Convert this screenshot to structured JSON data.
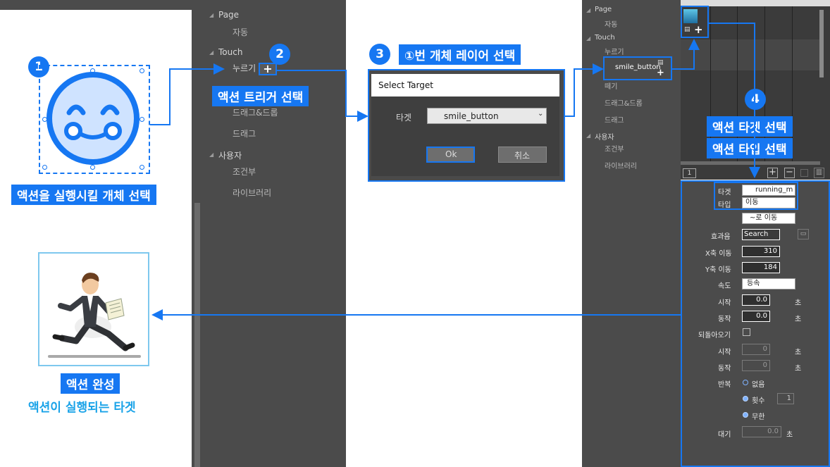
{
  "steps": {
    "step1": {
      "num": "1",
      "label": "액션을 실행시킬 개체 선택"
    },
    "step2": {
      "num": "2",
      "label": "액션 트리거 선택"
    },
    "step3": {
      "num": "3",
      "label": "①번 개체 레이어 선택"
    },
    "step4": {
      "num": "4",
      "label1": "액션 타겟 선택",
      "label2": "액션 타입 선택"
    },
    "done": {
      "label": "액션 완성",
      "sub": "액션이 실행되는 타겟"
    }
  },
  "trigger_panel": {
    "page_header": "Page",
    "page_items": [
      "자동"
    ],
    "touch_header": "Touch",
    "touch_items": [
      "누르기",
      "드래그&드롭",
      "드래그"
    ],
    "user_header": "사용자",
    "user_items": [
      "조건부",
      "라이브러리"
    ]
  },
  "dialog": {
    "title": "Select Target",
    "target_label": "타겟",
    "target_value": "smile_button",
    "ok": "Ok",
    "cancel": "취소"
  },
  "right_trigger_panel": {
    "page_header": "Page",
    "page_items": [
      "자동"
    ],
    "touch_header": "Touch",
    "touch_items": [
      "누르기",
      "떼기",
      "드래그&드롭",
      "드래그"
    ],
    "user_header": "사용자",
    "user_items": [
      "조건부",
      "라이브러리"
    ],
    "target_chip": "smile_button"
  },
  "timeline": {
    "page_number": "1"
  },
  "properties": {
    "target_label": "타겟",
    "target_value": "running_m",
    "type_label": "타입",
    "type_value": "이동",
    "move_mode": "~로 이동",
    "sound_label": "효과음",
    "sound_value": "Search",
    "x_label": "X축 이동",
    "x_value": "310",
    "y_label": "Y축 이동",
    "y_value": "184",
    "speed_label": "속도",
    "speed_value": "등속",
    "start_label": "시작",
    "start_value": "0.0",
    "dur_label": "동작",
    "dur_value": "0.0",
    "sec": "초",
    "return_label": "되돌아오기",
    "ret_start_label": "시작",
    "ret_start_value": "0",
    "ret_dur_label": "동작",
    "ret_dur_value": "0",
    "repeat_label": "반복",
    "repeat_none": "없음",
    "repeat_count": "횟수",
    "repeat_count_value": "1",
    "repeat_inf": "무한",
    "wait_label": "대기",
    "wait_value": "0.0"
  },
  "colors": {
    "accent": "#1677f2",
    "panel": "#4b4b4b",
    "light_blue": "#cfe3ff"
  }
}
